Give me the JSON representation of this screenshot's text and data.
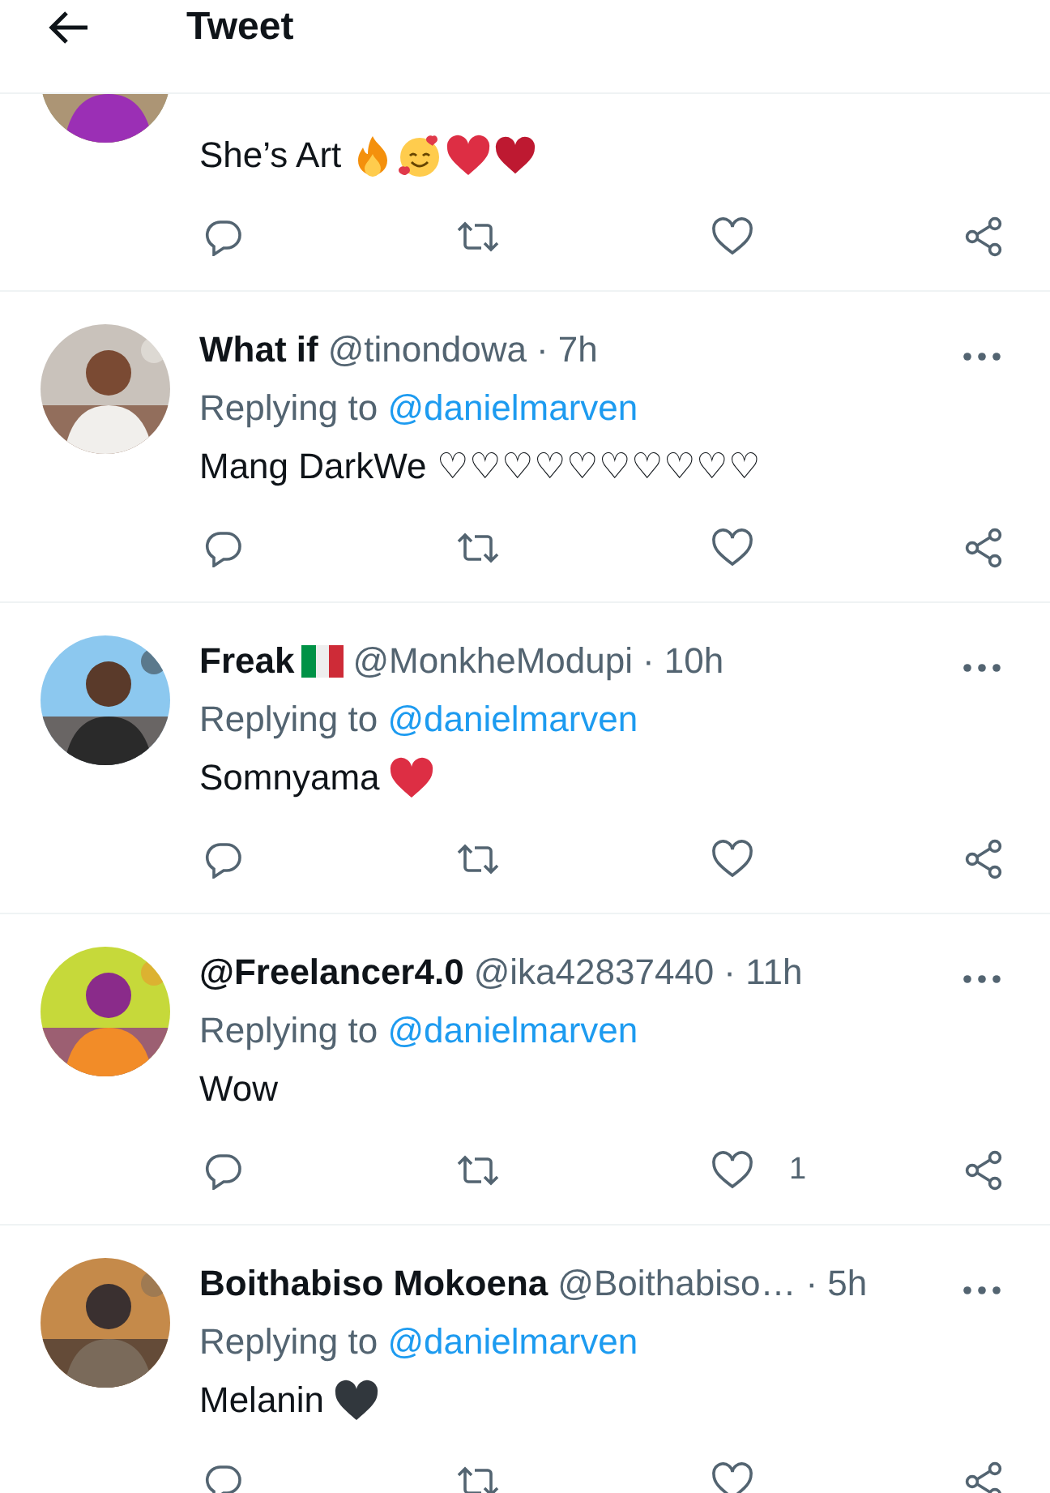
{
  "header": {
    "title": "Tweet"
  },
  "tweets": [
    {
      "text": "She’s Art",
      "emojis": [
        {
          "kind": "fire"
        },
        {
          "kind": "smiling-hearts"
        },
        {
          "kind": "heart-red"
        },
        {
          "kind": "heart-darkred"
        }
      ]
    },
    {
      "name": "What if",
      "handle": "@tinondowa",
      "time": "· 7h",
      "replying_prefix": "Replying to",
      "replying_handle": "@danielmarven",
      "text": "Mang DarkWe ♡♡♡♡♡♡♡♡♡♡"
    },
    {
      "name": "Freak",
      "name_emojis": [
        {
          "kind": "italy-flag"
        }
      ],
      "handle": "@MonkheModupi",
      "time": "· 10h",
      "replying_prefix": "Replying to",
      "replying_handle": "@danielmarven",
      "text": "Somnyama",
      "emojis": [
        {
          "kind": "heart-red"
        }
      ]
    },
    {
      "name": "@Freelancer4.0",
      "handle": "@ika42837440",
      "time": "· 11h",
      "replying_prefix": "Replying to",
      "replying_handle": "@danielmarven",
      "text": "Wow",
      "likes": "1"
    },
    {
      "name": "Boithabiso Mokoena",
      "handle": "@Boithabiso…",
      "time": "· 5h",
      "replying_prefix": "Replying to",
      "replying_handle": "@danielmarven",
      "text": "Melanin",
      "emojis": [
        {
          "kind": "heart-black"
        }
      ]
    }
  ]
}
